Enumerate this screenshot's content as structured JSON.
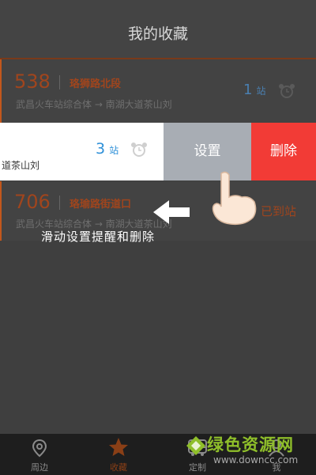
{
  "header": {
    "title": "我的收藏"
  },
  "cards": [
    {
      "route": "538",
      "stop": "珞狮路北段",
      "path": "武昌火车站综合体 → 南湖大道茶山刘",
      "count_num": "1",
      "count_unit": "站"
    },
    {
      "path_partial": "道茶山刘",
      "count_num": "3",
      "count_unit": "站"
    },
    {
      "route": "706",
      "stop": "珞瑜路街道口",
      "path": "武昌火车站综合体 → 南湖大道茶山刘",
      "status": "已到站"
    }
  ],
  "swipe_actions": {
    "set_label": "设置",
    "delete_label": "删除"
  },
  "overlay": {
    "hint": "滑动设置提醒和删除",
    "arrow_icon": "left-arrow-icon",
    "hand_icon": "pointing-hand-icon"
  },
  "tabs": [
    {
      "label": "周边",
      "icon": "location-pin-icon",
      "active": false
    },
    {
      "label": "收藏",
      "icon": "star-icon",
      "active": true
    },
    {
      "label": "定制",
      "icon": "bus-icon",
      "active": false
    },
    {
      "label": "我",
      "icon": "person-icon",
      "active": false
    }
  ],
  "watermark": {
    "title": "绿色资源网",
    "url": "www.downcc.com"
  },
  "colors": {
    "accent": "#c2571c",
    "delete": "#f23b36",
    "set": "#a8adb4",
    "count_blue": "#2e90d8"
  }
}
